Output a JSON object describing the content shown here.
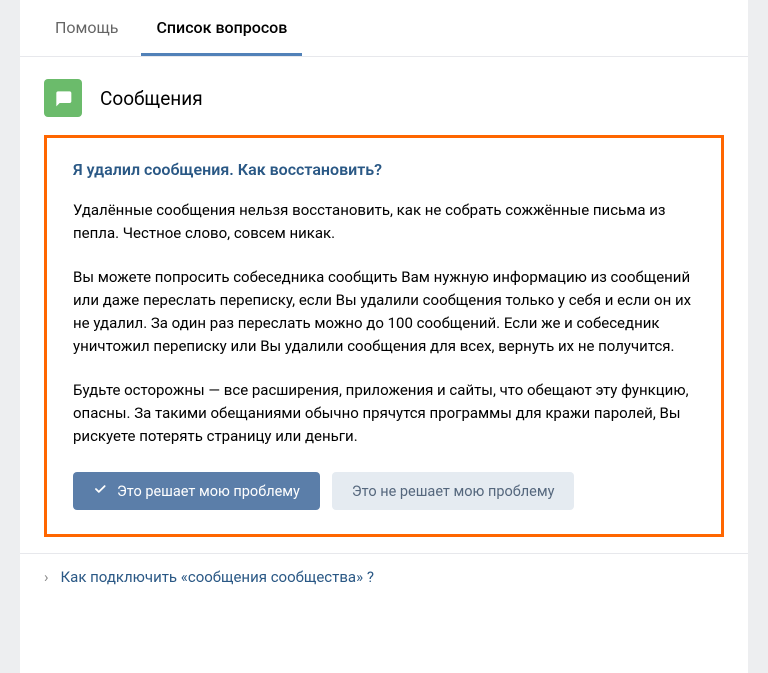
{
  "tabs": {
    "help": "Помощь",
    "questions": "Список вопросов"
  },
  "section": {
    "title": "Сообщения"
  },
  "faq": {
    "question": "Я удалил сообщения. Как восстановить?",
    "para1": "Удалённые сообщения нельзя восстановить, как не собрать сожжённые письма из пепла. Честное слово, совсем никак.",
    "para2": "Вы можете попросить собеседника сообщить Вам нужную информацию из сообщений или даже переслать переписку, если Вы удалили сообщения только у себя и если он их не удалил. За один раз переслать можно до 100 сообщений. Если же и собеседник уничтожил переписку или Вы удалили сообщения для всех, вернуть их не получится.",
    "para3": "Будьте осторожны — все расширения, приложения и сайты, что обещают эту функцию, опасны. За такими обещаниями обычно прячутся программы для кражи паролей, Вы рискуете потерять страницу или деньги."
  },
  "buttons": {
    "solves": "Это решает мою проблему",
    "not_solves": "Это не решает мою проблему"
  },
  "related": {
    "chevron": "›",
    "link1": "Как подключить «сообщения сообщества» ?"
  }
}
